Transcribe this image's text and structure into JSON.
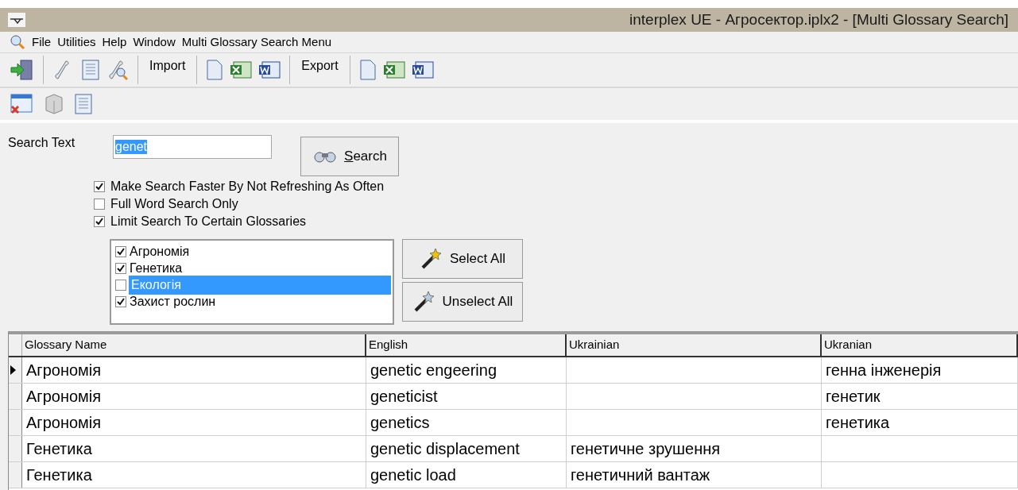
{
  "window": {
    "title": "interplex UE - Агросектор.iplx2 - [Multi Glossary Search]"
  },
  "menu": [
    "File",
    "Utilities",
    "Help",
    "Window",
    "Multi Glossary Search Menu"
  ],
  "toolbar": {
    "import_label": "Import",
    "export_label": "Export"
  },
  "search": {
    "label": "Search Text",
    "value": "genet",
    "button": "Search"
  },
  "options": [
    {
      "label": "Make Search Faster By Not Refreshing As Often",
      "checked": true
    },
    {
      "label": "Full Word Search Only",
      "checked": false
    },
    {
      "label": "Limit Search To Certain Glossaries",
      "checked": true
    }
  ],
  "glossaries": [
    {
      "label": "Агрономія",
      "checked": true,
      "selected": false
    },
    {
      "label": "Генетика",
      "checked": true,
      "selected": false
    },
    {
      "label": "Екологія",
      "checked": false,
      "selected": true
    },
    {
      "label": "Захист рослин",
      "checked": true,
      "selected": false
    }
  ],
  "list_buttons": [
    "Select All",
    "Unselect All"
  ],
  "table": {
    "columns": [
      "Glossary Name",
      "English",
      "Ukrainian",
      "Ukranian"
    ],
    "rows": [
      {
        "current": true,
        "cells": [
          "Агрономія",
          "genetic engeering",
          "",
          "генна інженерія"
        ]
      },
      {
        "current": false,
        "cells": [
          "Агрономія",
          "geneticist",
          "",
          "генетик"
        ]
      },
      {
        "current": false,
        "cells": [
          "Агрономія",
          "genetics",
          "",
          "генетика"
        ]
      },
      {
        "current": false,
        "cells": [
          "Генетика",
          "genetic displacement",
          "генетичне зрушення",
          ""
        ]
      },
      {
        "current": false,
        "cells": [
          "Генетика",
          "genetic load",
          "генетичний вантаж",
          ""
        ]
      }
    ]
  }
}
